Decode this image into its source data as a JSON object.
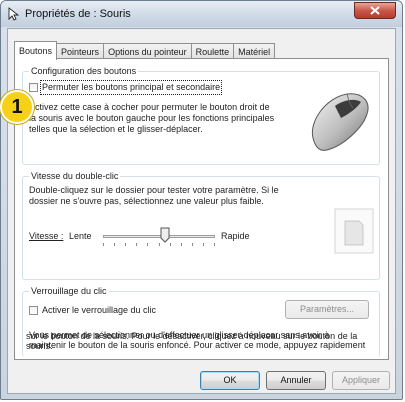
{
  "window": {
    "title": "Propriétés de : Souris"
  },
  "tabs": [
    {
      "label": "Boutons",
      "active": true
    },
    {
      "label": "Pointeurs",
      "active": false
    },
    {
      "label": "Options du pointeur",
      "active": false
    },
    {
      "label": "Roulette",
      "active": false
    },
    {
      "label": "Matériel",
      "active": false
    }
  ],
  "button_config": {
    "group_title": "Configuration des boutons",
    "checkbox_label": "Permuter les boutons principal et secondaire",
    "checked": false,
    "description_lines": [
      "Activez cette case à cocher pour permuter le bouton droit de",
      "la souris avec le bouton gauche pour les fonctions principales",
      "telles que la sélection et le glisser-déplacer."
    ]
  },
  "double_click": {
    "group_title": "Vitesse du double-clic",
    "description_lines": [
      "Double-cliquez sur le dossier pour tester votre paramètre. Si le",
      "dossier ne s'ouvre pas, sélectionnez une valeur plus faible."
    ],
    "speed_label": "Vitesse :",
    "slow_label": "Lente",
    "fast_label": "Rapide",
    "speed_level": 0.55
  },
  "click_lock": {
    "group_title": "Verrouillage du clic",
    "checkbox_label": "Activer le verrouillage du clic",
    "checked": false,
    "settings_button": "Paramètres...",
    "description_lines": [
      "Vous permet de sélectionner ou d'effectuer un glisser-déplacer sans avoir à",
      "maintenir le bouton de la souris enfoncé. Pour activer ce mode, appuyez rapidement",
      "sur le bouton de la souris. Pour le désactiver, cliquez à nouveau sur le bouton de la",
      "souris."
    ]
  },
  "footer": {
    "ok": "OK",
    "cancel": "Annuler",
    "apply": "Appliquer"
  },
  "callout": {
    "number": "1",
    "color": "#f7d117"
  },
  "icons": [
    "mouse-cursor-icon",
    "close-icon",
    "mouse-image",
    "folder-test-icon",
    "slider-thumb-icon"
  ]
}
